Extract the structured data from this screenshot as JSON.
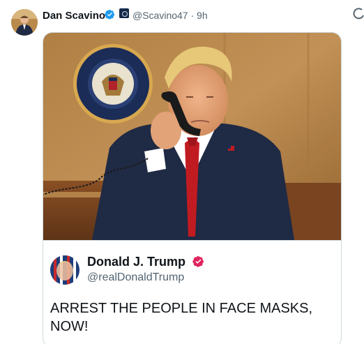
{
  "tweet": {
    "author_name": "Dan Scavino",
    "author_handle": "@Scavino47",
    "time_separator": " · ",
    "time": "9h",
    "avatar_icon": "user-avatar-photo",
    "verified_icon": "verified-badge-icon",
    "gov_icon": "government-affiliation-badge-icon",
    "more_icon": "more-options-icon"
  },
  "quoted": {
    "photo_description_icon": "tweet-photo",
    "author_name": "Donald J. Trump",
    "author_handle": "@realDonaldTrump",
    "text": "ARREST THE PEOPLE IN FACE MASKS, NOW!"
  },
  "colors": {
    "verified_blue": "#1d9bf0",
    "quoted_verified_red": "#e0245e",
    "secondary_text": "#536471",
    "border": "#cfd9de"
  }
}
